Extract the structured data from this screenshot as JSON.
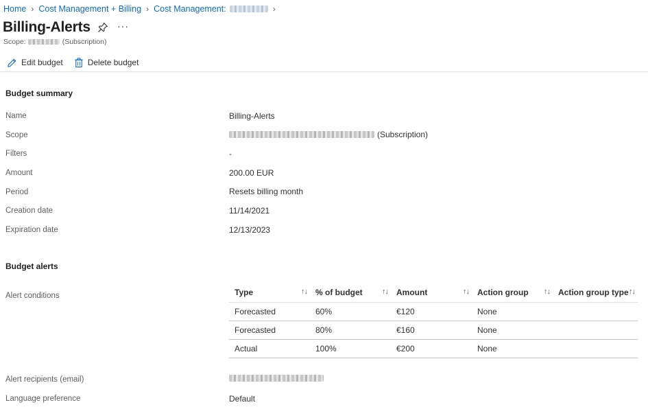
{
  "breadcrumb": {
    "items": [
      "Home",
      "Cost Management + Billing",
      "Cost Management:"
    ]
  },
  "header": {
    "title": "Billing-Alerts",
    "more_label": "···",
    "scope_prefix": "Scope:",
    "scope_suffix": "(Subscription)"
  },
  "toolbar": {
    "edit_label": "Edit budget",
    "delete_label": "Delete budget"
  },
  "summary": {
    "heading": "Budget summary",
    "rows": [
      {
        "label": "Name",
        "value": "Billing-Alerts"
      },
      {
        "label": "Scope",
        "value": "(Subscription)"
      },
      {
        "label": "Filters",
        "value": "-"
      },
      {
        "label": "Amount",
        "value": "200.00 EUR"
      },
      {
        "label": "Period",
        "value": "Resets billing month"
      },
      {
        "label": "Creation date",
        "value": "11/14/2021"
      },
      {
        "label": "Expiration date",
        "value": "12/13/2023"
      }
    ]
  },
  "alerts": {
    "heading": "Budget alerts",
    "conditions_label": "Alert conditions",
    "columns": [
      "Type",
      "% of budget",
      "Amount",
      "Action group",
      "Action group type"
    ],
    "rows": [
      {
        "type": "Forecasted",
        "percent": "60%",
        "amount": "€120",
        "action_group": "None",
        "action_group_type": ""
      },
      {
        "type": "Forecasted",
        "percent": "80%",
        "amount": "€160",
        "action_group": "None",
        "action_group_type": ""
      },
      {
        "type": "Actual",
        "percent": "100%",
        "amount": "€200",
        "action_group": "None",
        "action_group_type": ""
      }
    ],
    "recipients_label": "Alert recipients (email)",
    "language_label": "Language preference",
    "language_value": "Default"
  },
  "icons": {
    "pin": "pin-icon",
    "edit": "pencil-icon",
    "delete": "trash-icon",
    "sort": "sort-arrows-icon",
    "chevron": "chevron-right-icon"
  },
  "colors": {
    "link": "#0f6cbd",
    "text": "#323130",
    "muted": "#605e5c"
  }
}
